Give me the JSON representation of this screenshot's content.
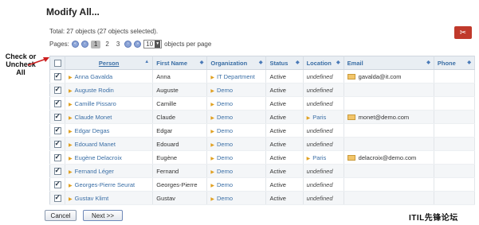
{
  "page": {
    "title": "Modify All...",
    "total_text": "Total: 27 objects (27 objects selected).",
    "pages_label": "Pages:",
    "pager": {
      "first_icon": "first-page-icon",
      "prev_icon": "prev-page-icon",
      "current_page": "1",
      "pages": [
        "2",
        "3"
      ],
      "next_icon": "next-page-icon",
      "last_icon": "last-page-icon",
      "per_page_value": "10",
      "per_page_label": "objects per page"
    },
    "toolbar": {
      "tools_icon": "tools-icon"
    }
  },
  "callout": {
    "text": "Check or Uncheck All"
  },
  "table": {
    "columns": [
      "Person",
      "First Name",
      "Organization",
      "Status",
      "Location",
      "Email",
      "Phone"
    ],
    "select_all_checked": false,
    "rows": [
      {
        "checked": true,
        "person": "Anna Gavalda",
        "first_name": "Anna",
        "organization": "IT Department",
        "status": "Active",
        "location": "undefined",
        "email": "gavalda@it.com",
        "phone": ""
      },
      {
        "checked": true,
        "person": "Auguste Rodin",
        "first_name": "Auguste",
        "organization": "Demo",
        "status": "Active",
        "location": "undefined",
        "email": "",
        "phone": ""
      },
      {
        "checked": true,
        "person": "Camille Pissaro",
        "first_name": "Camille",
        "organization": "Demo",
        "status": "Active",
        "location": "undefined",
        "email": "",
        "phone": ""
      },
      {
        "checked": true,
        "person": "Claude Monet",
        "first_name": "Claude",
        "organization": "Demo",
        "status": "Active",
        "location": "Paris",
        "email": "monet@demo.com",
        "phone": ""
      },
      {
        "checked": true,
        "person": "Edgar Degas",
        "first_name": "Edgar",
        "organization": "Demo",
        "status": "Active",
        "location": "undefined",
        "email": "",
        "phone": ""
      },
      {
        "checked": true,
        "person": "Edouard Manet",
        "first_name": "Edouard",
        "organization": "Demo",
        "status": "Active",
        "location": "undefined",
        "email": "",
        "phone": ""
      },
      {
        "checked": true,
        "person": "Eugène Delacroix",
        "first_name": "Eugène",
        "organization": "Demo",
        "status": "Active",
        "location": "Paris",
        "email": "delacroix@demo.com",
        "phone": ""
      },
      {
        "checked": true,
        "person": "Fernand Léger",
        "first_name": "Fernand",
        "organization": "Demo",
        "status": "Active",
        "location": "undefined",
        "email": "",
        "phone": ""
      },
      {
        "checked": true,
        "person": "Georges-Pierre Seurat",
        "first_name": "Georges-Pierre",
        "organization": "Demo",
        "status": "Active",
        "location": "undefined",
        "email": "",
        "phone": ""
      },
      {
        "checked": true,
        "person": "Gustav Klimt",
        "first_name": "Gustav",
        "organization": "Demo",
        "status": "Active",
        "location": "undefined",
        "email": "",
        "phone": ""
      }
    ]
  },
  "buttons": {
    "cancel": "Cancel",
    "next": "Next >>"
  },
  "watermark": "ITIL先锋论坛",
  "colors": {
    "link": "#3a6ea5",
    "header_bg": "#e9eef3",
    "tool_button": "#c0392b",
    "arrow": "#cc1f1f"
  }
}
